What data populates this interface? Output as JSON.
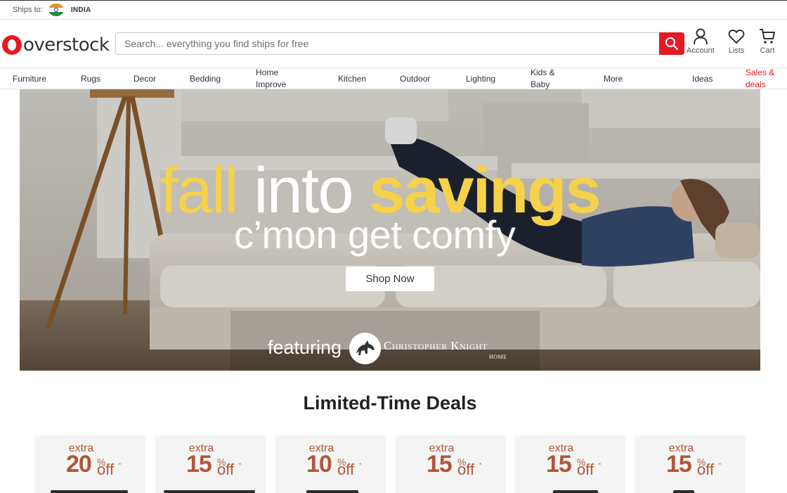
{
  "ship_bar": {
    "label": "Ships to:",
    "country": "INDIA"
  },
  "header": {
    "logo_text": "overstock",
    "search_placeholder": "Search... everything you find ships for free",
    "icons": [
      {
        "name": "account",
        "label": "Account"
      },
      {
        "name": "lists",
        "label": "Lists"
      },
      {
        "name": "cart",
        "label": "Cart"
      }
    ]
  },
  "nav": {
    "items": [
      {
        "line1": "Furniture",
        "line2": ""
      },
      {
        "line1": "Rugs",
        "line2": ""
      },
      {
        "line1": "Decor",
        "line2": ""
      },
      {
        "line1": "Bedding",
        "line2": ""
      },
      {
        "line1": "Home",
        "line2": "Improve"
      },
      {
        "line1": "Kitchen",
        "line2": ""
      },
      {
        "line1": "Outdoor",
        "line2": ""
      },
      {
        "line1": "Lighting",
        "line2": ""
      },
      {
        "line1": "Kids &",
        "line2": "Baby"
      },
      {
        "line1": "More",
        "line2": ""
      },
      {
        "line1": "Ideas",
        "line2": ""
      },
      {
        "line1": "Sales &",
        "line2": "deals"
      }
    ]
  },
  "hero": {
    "title_word1": "fall",
    "title_word2": "into",
    "title_word3": "savings",
    "subtitle": "c’mon get comfy",
    "cta": "Shop Now",
    "featuring": "featuring",
    "brand_name": "Christopher Knight",
    "brand_sub": "HOME"
  },
  "deals": {
    "title": "Limited-Time Deals",
    "cards": [
      {
        "extra": "extra",
        "percent": "20",
        "pct_sign": "%",
        "off": "off",
        "star": "*"
      },
      {
        "extra": "extra",
        "percent": "15",
        "pct_sign": "%",
        "off": "off",
        "star": "*"
      },
      {
        "extra": "extra",
        "percent": "10",
        "pct_sign": "%",
        "off": "off",
        "star": "*"
      },
      {
        "extra": "extra",
        "percent": "15",
        "pct_sign": "%",
        "off": "off",
        "star": "*"
      },
      {
        "extra": "extra",
        "percent": "15",
        "pct_sign": "%",
        "off": "off",
        "star": "*"
      },
      {
        "extra": "extra",
        "percent": "15",
        "pct_sign": "%",
        "off": "off",
        "star": "*"
      }
    ]
  },
  "colors": {
    "brand_red": "#e41a24",
    "hero_yellow": "#f6d24a",
    "deal_text": "#b0563a"
  }
}
